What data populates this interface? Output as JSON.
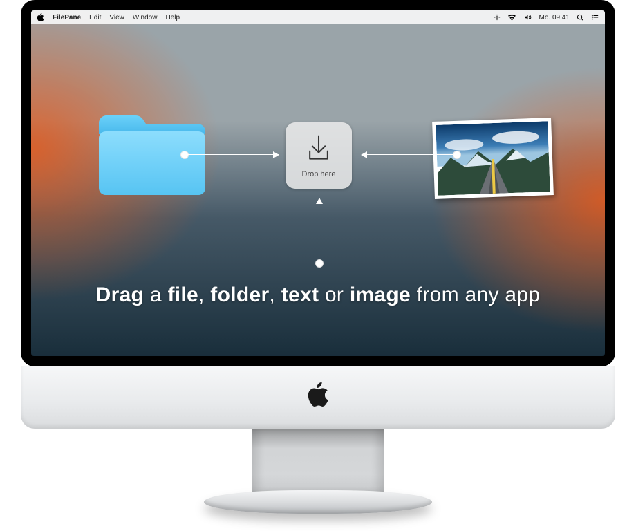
{
  "menubar": {
    "app_name": "FilePane",
    "items": [
      "Edit",
      "View",
      "Window",
      "Help"
    ],
    "clock": "Mo. 09:41"
  },
  "dropzone": {
    "label": "Drop here"
  },
  "headline": {
    "w1": "Drag",
    "t1": " a ",
    "w2": "file",
    "t2": ", ",
    "w3": "folder",
    "t3": ", ",
    "w4": "text",
    "t4": " or ",
    "w5": "image",
    "t5": " from any app"
  }
}
